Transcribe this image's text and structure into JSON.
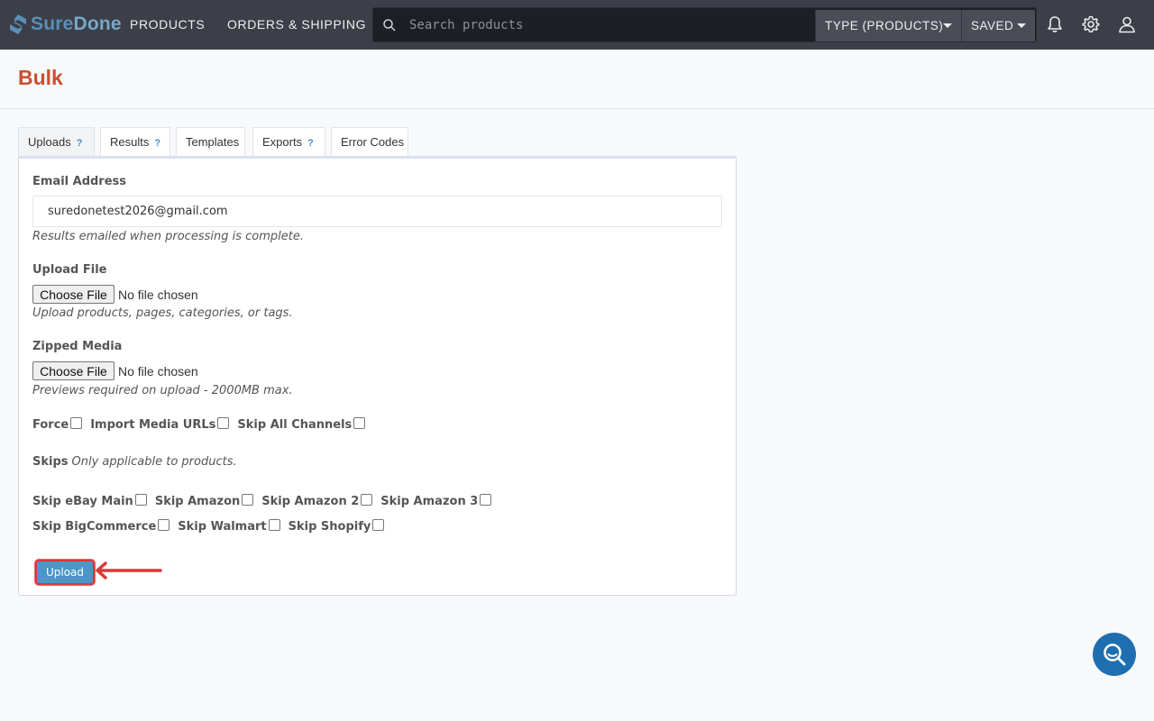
{
  "brand": {
    "part1": "Sure",
    "part2": "Done"
  },
  "nav": {
    "products": "PRODUCTS",
    "orders": "ORDERS & SHIPPING",
    "search_placeholder": "Search products",
    "type_dropdown": "TYPE (PRODUCTS)",
    "saved_dropdown": "SAVED",
    "icons": [
      "bell-icon",
      "gear-icon",
      "user-icon"
    ]
  },
  "page": {
    "title": "Bulk"
  },
  "tabs": [
    {
      "label": "Uploads",
      "help": "?"
    },
    {
      "label": "Results",
      "help": "?"
    },
    {
      "label": "Templates"
    },
    {
      "label": "Exports",
      "help": "?"
    },
    {
      "label": "Error Codes"
    }
  ],
  "form": {
    "email_label": "Email Address",
    "email_value": "suredonetest2026@gmail.com",
    "email_hint": "Results emailed when processing is complete.",
    "upload_file_label": "Upload File",
    "upload_file_button": "Choose File",
    "upload_file_status": "No file chosen",
    "upload_file_hint": "Upload products, pages, categories, or tags.",
    "zipped_label": "Zipped Media",
    "zipped_button": "Choose File",
    "zipped_status": "No file chosen",
    "zipped_hint": "Previews required on upload - 2000MB max.",
    "options": [
      "Force",
      "Import Media URLs",
      "Skip All Channels"
    ],
    "skips_label": "Skips",
    "skips_hint": "Only applicable to products.",
    "skip_row1": [
      "Skip eBay Main",
      "Skip Amazon",
      "Skip Amazon 2",
      "Skip Amazon 3"
    ],
    "skip_row2": [
      "Skip BigCommerce",
      "Skip Walmart",
      "Skip Shopify"
    ],
    "upload_button": "Upload"
  },
  "colors": {
    "topbar": "#3c3f48",
    "title": "#c94f2f",
    "primary_button": "#4a97c8",
    "annotation": "#d9383a",
    "chat": "#1f6fb0"
  }
}
